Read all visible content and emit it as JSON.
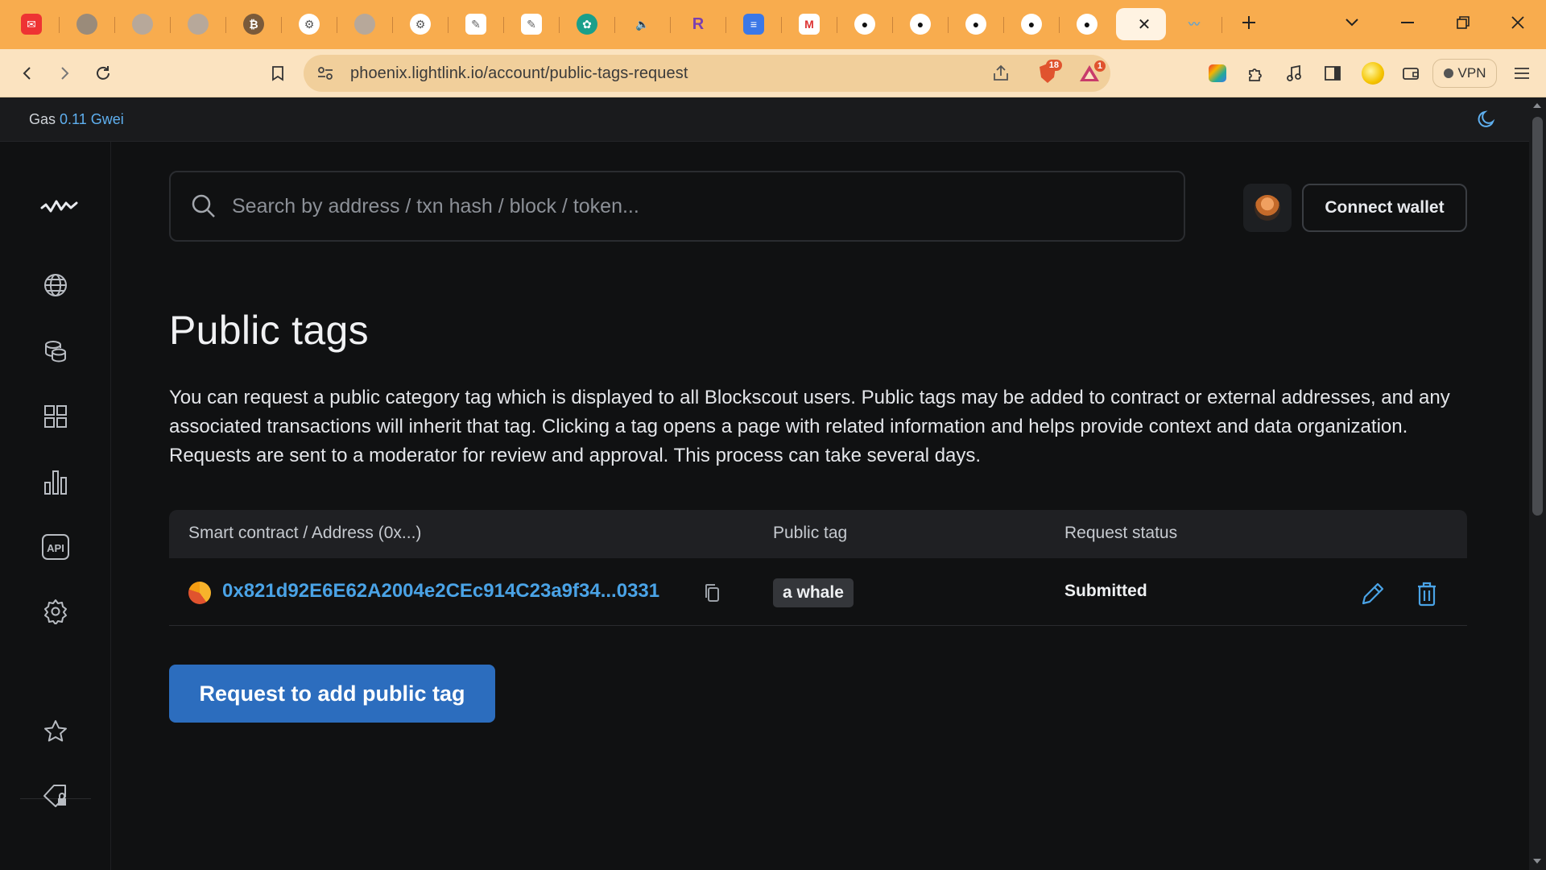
{
  "browser": {
    "tabs": [
      {
        "icon": "gmail-red-icon",
        "active": false
      },
      {
        "icon": "grey-circle-icon",
        "active": false
      },
      {
        "icon": "grey-circle-icon",
        "active": false
      },
      {
        "icon": "grey-circle-icon",
        "active": false
      },
      {
        "icon": "coin-icon",
        "active": false
      },
      {
        "icon": "robot-icon",
        "active": false
      },
      {
        "icon": "grey-circle-icon",
        "active": false
      },
      {
        "icon": "robot-icon",
        "active": false
      },
      {
        "icon": "note-icon",
        "active": false
      },
      {
        "icon": "note-icon",
        "active": false
      },
      {
        "icon": "chatgpt-icon",
        "active": false
      },
      {
        "icon": "speaker-icon",
        "active": false
      },
      {
        "icon": "r-letter-icon",
        "active": false
      },
      {
        "icon": "google-docs-icon",
        "active": false
      },
      {
        "icon": "gmail-icon",
        "active": false
      },
      {
        "icon": "github-icon",
        "active": false
      },
      {
        "icon": "github-icon",
        "active": false
      },
      {
        "icon": "github-icon",
        "active": false
      },
      {
        "icon": "github-icon",
        "active": false
      },
      {
        "icon": "github-icon",
        "active": false
      },
      {
        "icon": "close-icon",
        "active": true
      },
      {
        "icon": "lightlink-icon",
        "active": false
      }
    ],
    "url": "phoenix.lightlink.io/account/public-tags-request",
    "brave_badge": "18",
    "rewards_badge": "1",
    "vpn_label": "VPN"
  },
  "gas": {
    "label": "Gas",
    "value": "0.11 Gwei"
  },
  "search": {
    "placeholder": "Search by address / txn hash / block / token..."
  },
  "header": {
    "connect_label": "Connect wallet"
  },
  "page": {
    "title": "Public tags",
    "description": "You can request a public category tag which is displayed to all Blockscout users. Public tags may be added to contract or external addresses, and any associated transactions will inherit that tag. Clicking a tag opens a page with related information and helps provide context and data organization. Requests are sent to a moderator for review and approval. This process can take several days."
  },
  "table": {
    "columns": [
      "Smart contract / Address (0x...)",
      "Public tag",
      "Request status"
    ],
    "rows": [
      {
        "address": "0x821d92E6E62A2004e2CEc914C23a9f34...0331",
        "tag": "a whale",
        "status": "Submitted"
      }
    ]
  },
  "actions": {
    "request_label": "Request to add public tag"
  },
  "colors": {
    "accent": "#4aa3e6",
    "button": "#2c6dbe",
    "tabbar": "#f8ac4e"
  }
}
